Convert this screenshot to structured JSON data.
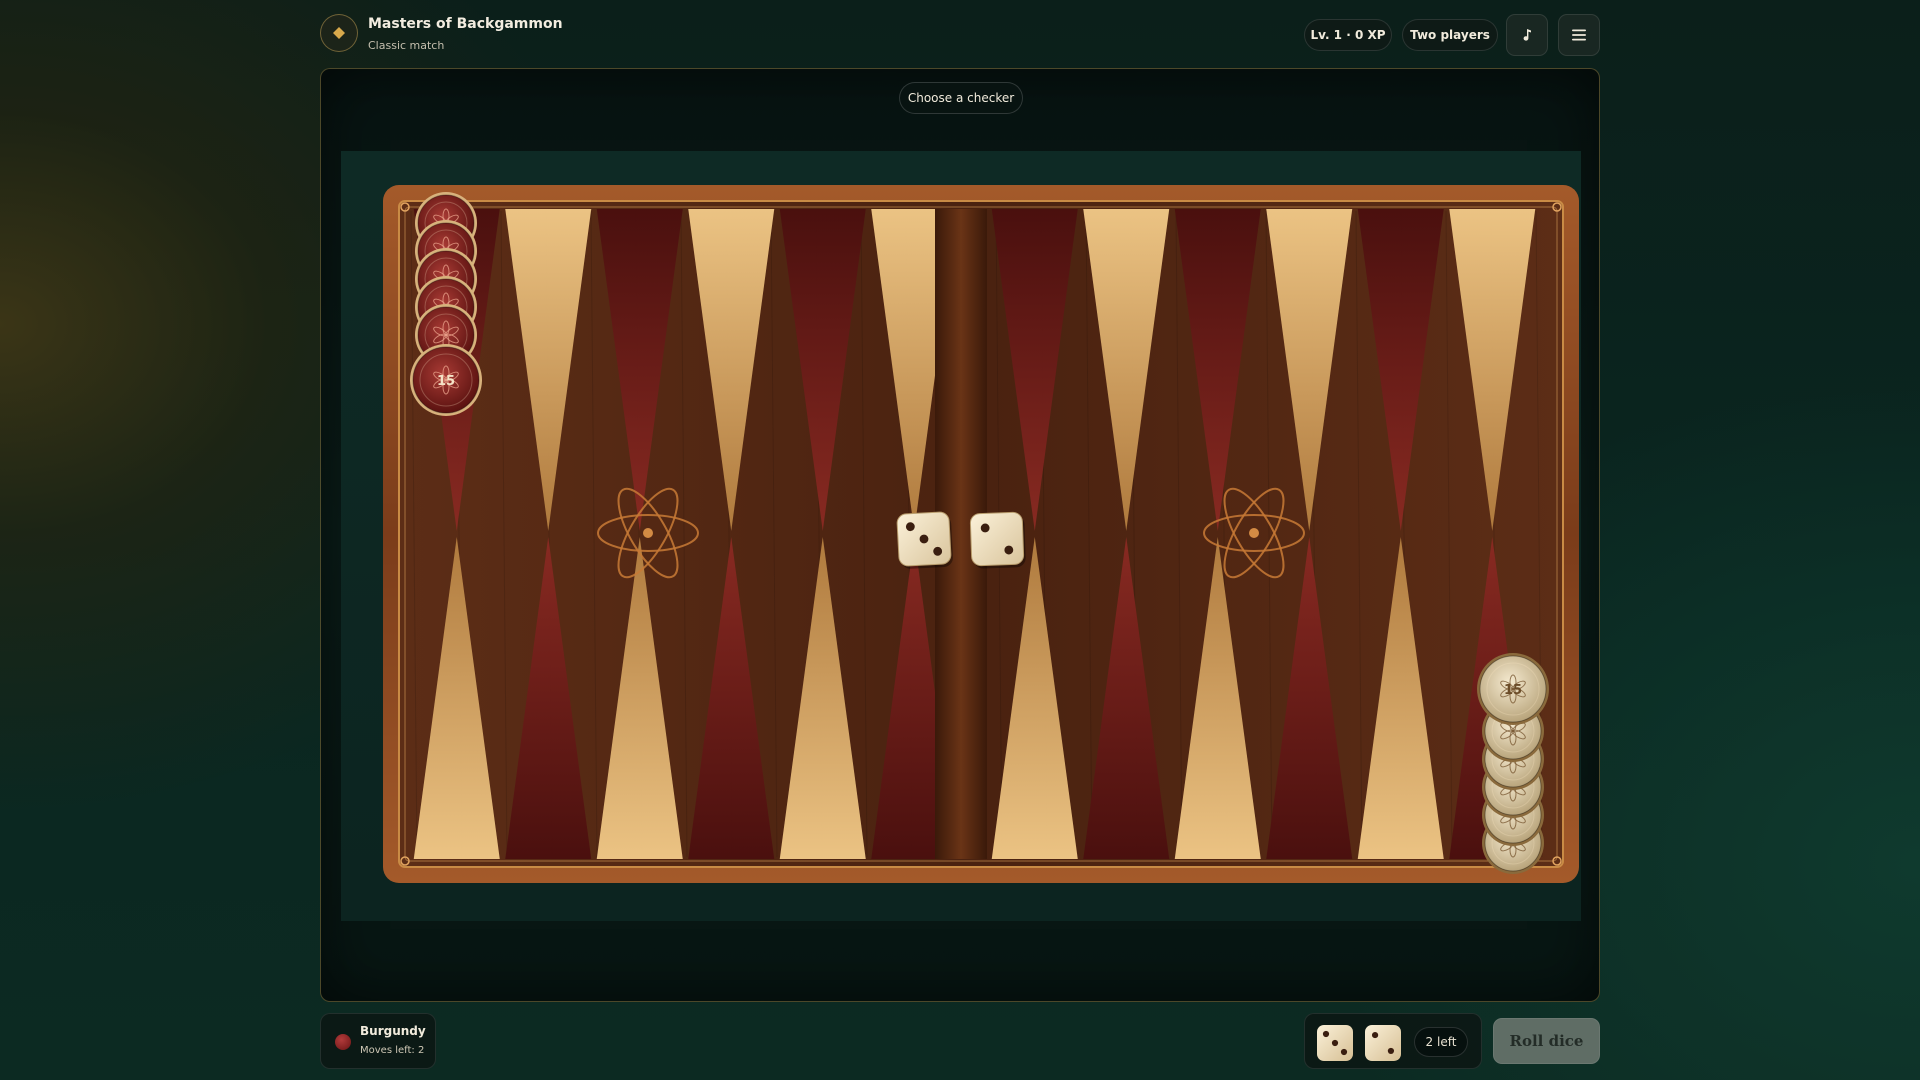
{
  "app": {
    "title": "Masters of Backgammon",
    "subtitle": "Classic match",
    "logo_icon": "diamond-icon"
  },
  "header": {
    "level_label": "Lv. 1 · 0 XP",
    "mode_label": "Two players",
    "music_icon": "music-note-icon",
    "menu_icon": "hamburger-menu-icon"
  },
  "board": {
    "prompt": "Choose a checker",
    "burgundy_stack": {
      "point": 12,
      "count": 15,
      "count_label": "15"
    },
    "ivory_stack": {
      "point": 1,
      "count": 15,
      "count_label": "15"
    },
    "dice": [
      3,
      2
    ],
    "decor_icon": "atom-ornament-icon",
    "colors": {
      "frame": "#8a4520",
      "felt": "#5a2c16",
      "point_light": "#e6b773",
      "point_dark": "#6a1a16",
      "burgundy_checker": "#7a1f1c",
      "ivory_checker": "#d9c9a3"
    }
  },
  "footer": {
    "player_name": "Burgundy",
    "moves_left": "Moves left: 2",
    "dice_remaining": "2 left",
    "roll_button": "Roll dice",
    "colors": {
      "roll_button_bg": "#5f6d65"
    }
  }
}
